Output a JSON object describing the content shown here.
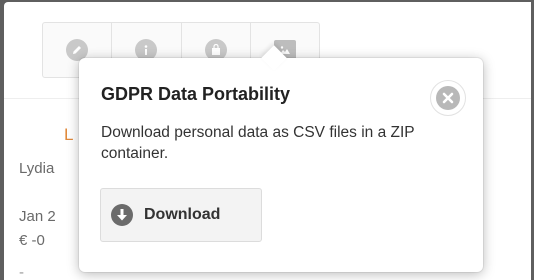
{
  "toolbar": {
    "tools": [
      {
        "name": "edit",
        "icon": "pencil-icon"
      },
      {
        "name": "info",
        "icon": "info-icon"
      },
      {
        "name": "bag",
        "icon": "shopping-bag-icon"
      },
      {
        "name": "images",
        "icon": "image-icon"
      }
    ]
  },
  "background": {
    "name_initial": "L",
    "name_line": "Lydia",
    "date_line": "Jan 2",
    "amount_line": "€ -0",
    "dash": "-"
  },
  "popover": {
    "title": "GDPR Data Portability",
    "description": "Download personal data as CSV files in a ZIP container.",
    "download_label": "Download"
  },
  "colors": {
    "accent_orange": "#e0893a",
    "icon_grey": "#c9c9c9"
  }
}
